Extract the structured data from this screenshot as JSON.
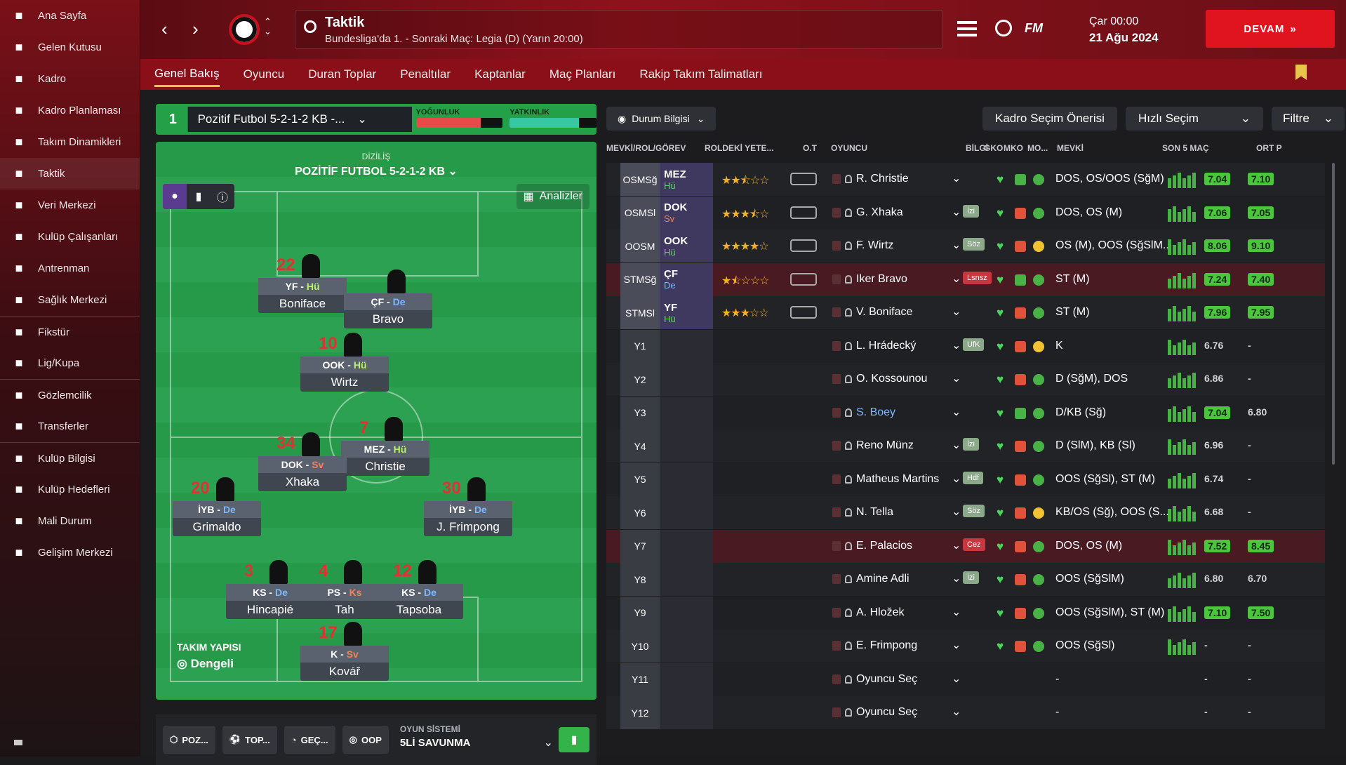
{
  "sidebar": {
    "items": [
      {
        "label": "Ana Sayfa",
        "icon": "home-icon"
      },
      {
        "label": "Gelen Kutusu",
        "icon": "inbox-icon"
      },
      {
        "label": "Kadro",
        "icon": "shirt-icon"
      },
      {
        "label": "Kadro Planlaması",
        "icon": "clipboard-icon"
      },
      {
        "label": "Takım Dinamikleri",
        "icon": "dynamics-icon"
      },
      {
        "label": "Taktik",
        "icon": "tactics-icon"
      },
      {
        "label": "Veri Merkezi",
        "icon": "data-icon"
      },
      {
        "label": "Kulüp Çalışanları",
        "icon": "staff-icon"
      },
      {
        "label": "Antrenman",
        "icon": "training-icon"
      },
      {
        "label": "Sağlık Merkezi",
        "icon": "medical-icon"
      },
      {
        "label": "Fikstür",
        "icon": "calendar-icon"
      },
      {
        "label": "Lig/Kupa",
        "icon": "trophy-icon"
      },
      {
        "label": "Gözlemcilik",
        "icon": "search-icon"
      },
      {
        "label": "Transferler",
        "icon": "transfer-icon"
      },
      {
        "label": "Kulüp Bilgisi",
        "icon": "shield-icon"
      },
      {
        "label": "Kulüp Hedefleri",
        "icon": "goals-icon"
      },
      {
        "label": "Mali Durum",
        "icon": "money-icon"
      },
      {
        "label": "Gelişim Merkezi",
        "icon": "growth-icon"
      }
    ]
  },
  "header": {
    "title": "Taktik",
    "subtitle": "Bundesliga'da 1. - Sonraki Maç: Legia (D) (Yarın 20:00)",
    "date_day": "Çar 00:00",
    "date": "21 Ağu 2024",
    "continue": "DEVAM",
    "fm": "FM"
  },
  "tabs": [
    "Genel Bakış",
    "Oyuncu",
    "Duran Toplar",
    "Penaltılar",
    "Kaptanlar",
    "Maç Planları",
    "Rakip Takım Talimatları"
  ],
  "tactic": {
    "slot": "1",
    "name": "Pozitif Futbol 5-2-1-2 KB -...",
    "intensity_label": "YOĞUNLUK",
    "familiarity_label": "YATKINLIK",
    "intensity": 0.75,
    "familiarity": 0.8,
    "formation_label": "DİZİLİŞ",
    "formation": "POZİTİF FUTBOL 5-2-1-2 KB",
    "analyze": "Analizler",
    "structure_label": "TAKIM YAPISI",
    "structure": "Dengeli"
  },
  "pitch_players": [
    {
      "num": "22",
      "role": "YF",
      "duty": "Hü",
      "name": "Boniface"
    },
    {
      "num": "",
      "role": "ÇF",
      "duty": "De",
      "name": "Bravo"
    },
    {
      "num": "10",
      "role": "OOK",
      "duty": "Hü",
      "name": "Wirtz"
    },
    {
      "num": "7",
      "role": "MEZ",
      "duty": "Hü",
      "name": "Christie"
    },
    {
      "num": "34",
      "role": "DOK",
      "duty": "Sv",
      "name": "Xhaka"
    },
    {
      "num": "20",
      "role": "İYB",
      "duty": "De",
      "name": "Grimaldo"
    },
    {
      "num": "30",
      "role": "İYB",
      "duty": "De",
      "name": "J. Frimpong"
    },
    {
      "num": "3",
      "role": "KS",
      "duty": "De",
      "name": "Hincapié"
    },
    {
      "num": "4",
      "role": "PS",
      "duty": "Ks",
      "name": "Tah"
    },
    {
      "num": "12",
      "role": "KS",
      "duty": "De",
      "name": "Tapsoba"
    },
    {
      "num": "17",
      "role": "K",
      "duty": "Sv",
      "name": "Kovář"
    }
  ],
  "bottom": {
    "poz": "POZ...",
    "top": "TOP...",
    "gec": "GEÇ...",
    "oop": "OOP",
    "system_label": "OYUN SİSTEMİ",
    "system": "5Lİ SAVUNMA"
  },
  "table_controls": {
    "status": "Durum Bilgisi",
    "suggest": "Kadro Seçim Önerisi",
    "quick": "Hızlı Seçim",
    "filter": "Filtre"
  },
  "columns": [
    "MEVKİ/ROL/GÖREV",
    "ROLDEKİ YETE...",
    "O.T",
    "OYUNCU",
    "BİLGİ",
    "GKO",
    "MKO",
    "MO...",
    "MEVKİ",
    "SON 5 MAÇ",
    "ORT P"
  ],
  "rows": [
    {
      "pos": "OSMSğ",
      "role": "MEZ",
      "duty": "Hü",
      "stars": 2.5,
      "player": "R. Christie",
      "info": "",
      "position": "DOS, OS/OOS (SğM)",
      "form": "7.04",
      "avg": "7.10"
    },
    {
      "pos": "OSMSl",
      "role": "DOK",
      "duty": "Sv",
      "stars": 3.5,
      "player": "G. Xhaka",
      "info": "İzi",
      "position": "DOS, OS (M)",
      "form": "7.06",
      "avg": "7.05"
    },
    {
      "pos": "OOSM",
      "role": "OOK",
      "duty": "Hü",
      "stars": 4,
      "player": "F. Wirtz",
      "info": "Söz",
      "position": "OS (M), OOS (SğSlM...",
      "form": "8.06",
      "avg": "9.10"
    },
    {
      "pos": "STMSğ",
      "role": "ÇF",
      "duty": "De",
      "stars": 1.5,
      "player": "Iker Bravo",
      "info": "Lsnsz",
      "position": "ST (M)",
      "form": "7.24",
      "avg": "7.40"
    },
    {
      "pos": "STMSl",
      "role": "YF",
      "duty": "Hü",
      "stars": 3,
      "player": "V. Boniface",
      "info": "",
      "position": "ST (M)",
      "form": "7.96",
      "avg": "7.95"
    },
    {
      "pos": "Y1",
      "role": "",
      "duty": "",
      "stars": 0,
      "player": "L. Hrádecký",
      "info": "UfK",
      "position": "K",
      "form": "6.76",
      "avg": "-"
    },
    {
      "pos": "Y2",
      "role": "",
      "duty": "",
      "stars": 0,
      "player": "O. Kossounou",
      "info": "",
      "position": "D (SğM), DOS",
      "form": "6.86",
      "avg": "-"
    },
    {
      "pos": "Y3",
      "role": "",
      "duty": "",
      "stars": 0,
      "player": "S. Boey",
      "info": "",
      "position": "D/KB (Sğ)",
      "form": "7.04",
      "avg": "6.80"
    },
    {
      "pos": "Y4",
      "role": "",
      "duty": "",
      "stars": 0,
      "player": "Reno Münz",
      "info": "İzi",
      "position": "D (SlM), KB (Sl)",
      "form": "6.96",
      "avg": "-"
    },
    {
      "pos": "Y5",
      "role": "",
      "duty": "",
      "stars": 0,
      "player": "Matheus Martins",
      "info": "Hdf",
      "position": "OOS (SğSl), ST (M)",
      "form": "6.74",
      "avg": "-"
    },
    {
      "pos": "Y6",
      "role": "",
      "duty": "",
      "stars": 0,
      "player": "N. Tella",
      "info": "Söz",
      "position": "KB/OS (Sğ), OOS (S...",
      "form": "6.68",
      "avg": "-"
    },
    {
      "pos": "Y7",
      "role": "",
      "duty": "",
      "stars": 0,
      "player": "E. Palacios",
      "info": "Cez",
      "position": "DOS, OS (M)",
      "form": "7.52",
      "avg": "8.45"
    },
    {
      "pos": "Y8",
      "role": "",
      "duty": "",
      "stars": 0,
      "player": "Amine Adli",
      "info": "İzi",
      "position": "OOS (SğSlM)",
      "form": "6.80",
      "avg": "6.70"
    },
    {
      "pos": "Y9",
      "role": "",
      "duty": "",
      "stars": 0,
      "player": "A. Hložek",
      "info": "",
      "position": "OOS (SğSlM), ST (M)",
      "form": "7.10",
      "avg": "7.50"
    },
    {
      "pos": "Y10",
      "role": "",
      "duty": "",
      "stars": 0,
      "player": "E. Frimpong",
      "info": "",
      "position": "OOS (SğSl)",
      "form": "-",
      "avg": "-"
    },
    {
      "pos": "Y11",
      "role": "",
      "duty": "",
      "stars": 0,
      "player": "Oyuncu Seç",
      "info": "",
      "position": "-",
      "form": "-",
      "avg": "-"
    },
    {
      "pos": "Y12",
      "role": "",
      "duty": "",
      "stars": 0,
      "player": "Oyuncu Seç",
      "info": "",
      "position": "-",
      "form": "-",
      "avg": "-"
    }
  ],
  "colors": {
    "accent": "#8a0f18",
    "pitch": "#279a49",
    "gold": "#e8c64b",
    "green": "#4bc63c",
    "continue": "#e0141e"
  }
}
